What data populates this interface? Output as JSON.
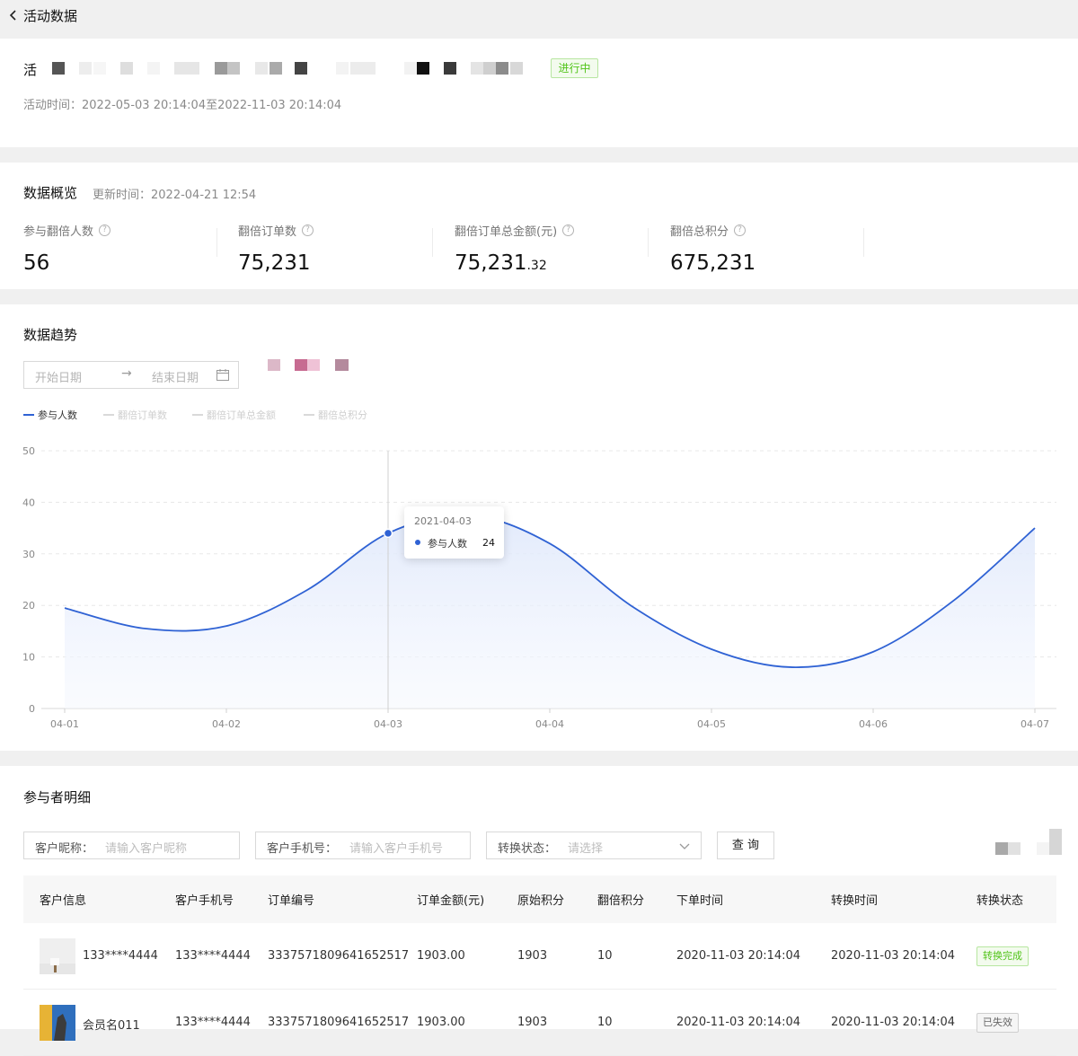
{
  "header": {
    "back_label": "活动数据"
  },
  "activity": {
    "title_visible": "活",
    "status": "进行中",
    "time_label": "活动时间：",
    "time_value": "2022-05-03 20:14:04至2022-11-03 20:14:04"
  },
  "overview": {
    "title": "数据概览",
    "update_label": "更新时间：",
    "update_value": "2022-04-21 12:54",
    "metrics": [
      {
        "label": "参与翻倍人数",
        "value": "56"
      },
      {
        "label": "翻倍订单数",
        "value": "75,231"
      },
      {
        "label": "翻倍订单总金额(元)",
        "value_int": "75,231",
        "value_dec": ".32"
      },
      {
        "label": "翻倍总积分",
        "value": "675,231"
      }
    ]
  },
  "trend": {
    "title": "数据趋势",
    "date_start_placeholder": "开始日期",
    "date_end_placeholder": "结束日期",
    "legend": [
      {
        "name": "参与人数",
        "color": "#2f62d4",
        "active": true
      },
      {
        "name": "翻倍订单数",
        "color": "#d9d9d9",
        "active": false
      },
      {
        "name": "翻倍订单总金额",
        "color": "#d9d9d9",
        "active": false
      },
      {
        "name": "翻倍总积分",
        "color": "#d9d9d9",
        "active": false
      }
    ],
    "tooltip": {
      "date": "2021-04-03",
      "series": "参与人数",
      "value": "24"
    }
  },
  "chart_data": {
    "type": "area",
    "categories": [
      "04-01",
      "04-02",
      "04-03",
      "04-04",
      "04-05",
      "04-06",
      "04-07"
    ],
    "x": [
      0,
      0.5,
      1,
      1.5,
      2,
      2.5,
      3,
      3.5,
      4,
      4.5,
      5,
      5.5,
      6
    ],
    "series": [
      {
        "name": "参与人数",
        "values": [
          19.5,
          15.5,
          16,
          23,
          34,
          37.5,
          32,
          20,
          11.5,
          8,
          11,
          21,
          35
        ]
      }
    ],
    "yticks": [
      0,
      10,
      20,
      30,
      40,
      50
    ],
    "ylim": [
      0,
      50
    ],
    "grid": true,
    "line_color": "#2f62d4",
    "highlight_category": "04-03"
  },
  "participants": {
    "title": "参与者明细",
    "filters": {
      "nickname_label": "客户昵称：",
      "nickname_placeholder": "请输入客户昵称",
      "phone_label": "客户手机号：",
      "phone_placeholder": "请输入客户手机号",
      "status_label": "转换状态：",
      "status_placeholder": "请选择",
      "query_label": "查 询"
    },
    "columns": [
      "客户信息",
      "客户手机号",
      "订单编号",
      "订单金额(元)",
      "原始积分",
      "翻倍积分",
      "下单时间",
      "转换时间",
      "转换状态"
    ],
    "rows": [
      {
        "name": "133****4444",
        "phone": "133****4444",
        "order_no": "3337571809641652517",
        "amount": "1903.00",
        "orig_points": "1903",
        "double_points": "10",
        "order_time": "2020-11-03 20:14:04",
        "convert_time": "2020-11-03 20:14:04",
        "status": "转换完成",
        "status_kind": "done"
      },
      {
        "name": "会员名011",
        "phone": "133****4444",
        "order_no": "3337571809641652517",
        "amount": "1903.00",
        "orig_points": "1903",
        "double_points": "10",
        "order_time": "2020-11-03 20:14:04",
        "convert_time": "2020-11-03 20:14:04",
        "status": "已失效",
        "status_kind": "expired"
      }
    ]
  }
}
